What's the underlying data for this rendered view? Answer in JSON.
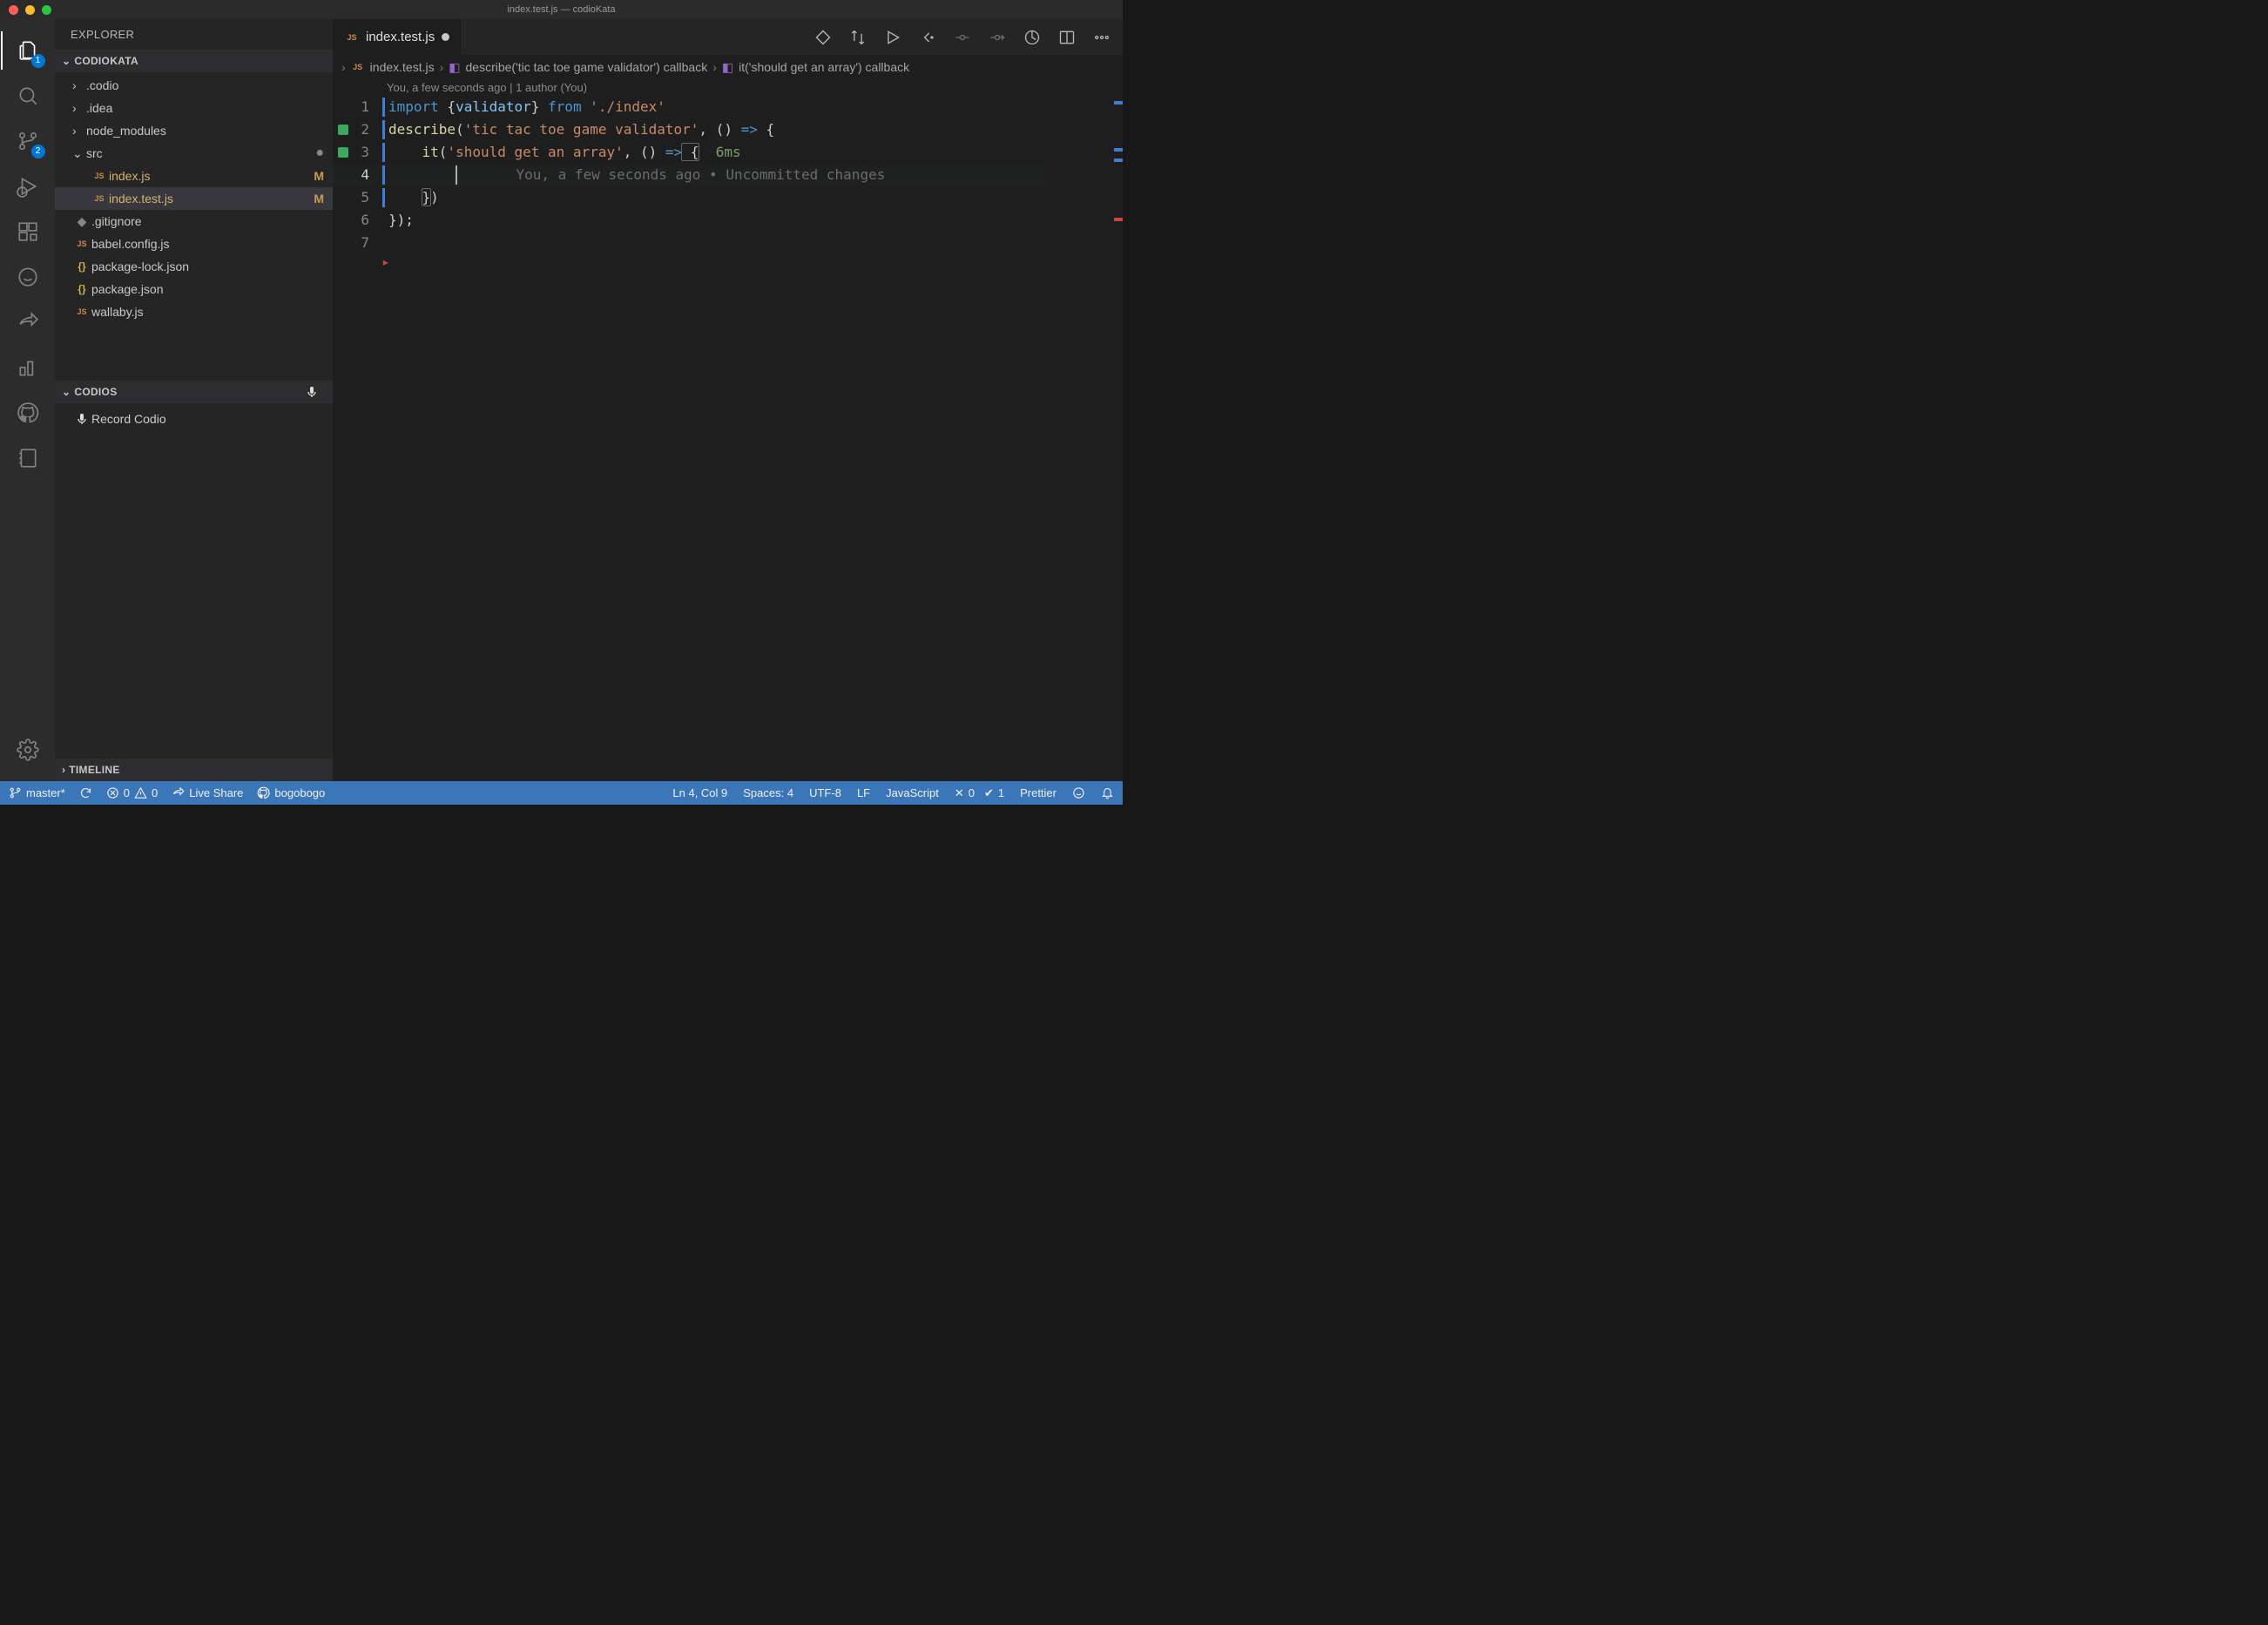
{
  "titlebar": {
    "title": "index.test.js — codioKata"
  },
  "activitybar": {
    "explorer_badge": "1",
    "scm_badge": "2"
  },
  "sidebar": {
    "title": "EXPLORER",
    "project_section": "CODIOKATA",
    "tree": {
      "codio": ".codio",
      "idea": ".idea",
      "node_modules": "node_modules",
      "src": "src",
      "src_dirty": "●",
      "index_js": "index.js",
      "index_js_status": "M",
      "index_test_js": "index.test.js",
      "index_test_js_status": "M",
      "gitignore": ".gitignore",
      "babel": "babel.config.js",
      "pkg_lock": "package-lock.json",
      "pkg": "package.json",
      "wallaby": "wallaby.js"
    },
    "codios_section": "CODIOS",
    "record_codio": "Record Codio",
    "timeline_section": "TIMELINE"
  },
  "tabs": {
    "file": "index.test.js"
  },
  "breadcrumbs": {
    "file": "index.test.js",
    "describe": "describe('tic tac toe game validator') callback",
    "it": "it('should get an array') callback"
  },
  "codelens": {
    "text": "You, a few seconds ago | 1 author (You)"
  },
  "code": {
    "l1_import": "import",
    "l1_brace_open": " {",
    "l1_validator": "validator",
    "l1_brace_close": "}",
    "l1_from": " from ",
    "l1_path": "'./index'",
    "l2_describe": "describe",
    "l2_open": "(",
    "l2_str": "'tic tac toe game validator'",
    "l2_mid": ", () ",
    "l2_arrow": "=>",
    "l2_end": " {",
    "l3_indent": "    ",
    "l3_it": "it",
    "l3_open": "(",
    "l3_str": "'should get an array'",
    "l3_mid": ", () ",
    "l3_arrow": "=>",
    "l3_brace": " {",
    "l3_time": "  6ms",
    "l4_indent": "        ",
    "l4_lens": "You, a few seconds ago • Uncommitted changes",
    "l5_indent": "    ",
    "l5_close": "})",
    "l6": "});",
    "l7": ""
  },
  "line_numbers": {
    "1": "1",
    "2": "2",
    "3": "3",
    "4": "4",
    "5": "5",
    "6": "6",
    "7": "7"
  },
  "statusbar": {
    "branch": "master*",
    "errors": "0",
    "warnings": "0",
    "liveshare": "Live Share",
    "user": "bogobogo",
    "cursor": "Ln 4, Col 9",
    "spaces": "Spaces: 4",
    "encoding": "UTF-8",
    "eol": "LF",
    "lang": "JavaScript",
    "tests_fail": "0",
    "tests_pass": "1",
    "prettier": "Prettier"
  }
}
